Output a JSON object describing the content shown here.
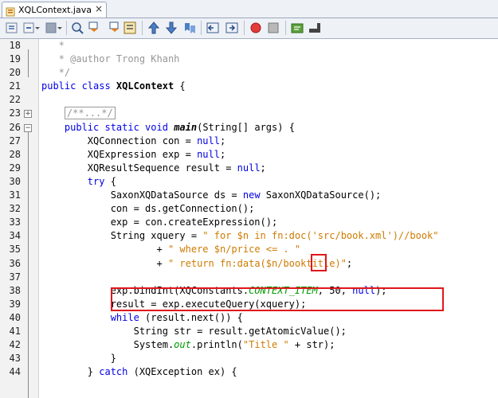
{
  "tab": {
    "label": "XQLContext.java",
    "close": "×"
  },
  "toolbar": {
    "icons": [
      "source-history-icon",
      "back-history-icon",
      "forward-history-icon",
      "find-icon",
      "prev-match-icon",
      "next-match-icon",
      "toggle-highlight-icon",
      "prev-bookmark-icon",
      "next-bookmark-icon",
      "toggle-bookmark-icon",
      "shift-left-icon",
      "shift-right-icon",
      "record-macro-icon",
      "stop-macro-icon",
      "comment-icon",
      "uncomment-icon"
    ]
  },
  "colors": {
    "keyword": "#0000e6",
    "string": "#ce7b00",
    "comment": "#969696",
    "constant": "#009900",
    "highlight": "#e0161b"
  },
  "code_lines": [
    {
      "n": "18",
      "segments": [
        {
          "t": "   *",
          "c": "cmt"
        }
      ]
    },
    {
      "n": "19",
      "segments": [
        {
          "t": "   * @author Trong Khanh",
          "c": "cmt"
        }
      ]
    },
    {
      "n": "20",
      "segments": [
        {
          "t": "   */",
          "c": "cmt"
        }
      ]
    },
    {
      "n": "21",
      "segments": [
        {
          "t": "public class ",
          "c": "kw"
        },
        {
          "t": "XQLContext",
          "c": "bold"
        },
        {
          "t": " {",
          "c": ""
        }
      ]
    },
    {
      "n": "22",
      "segments": []
    },
    {
      "n": "23",
      "segments": [
        {
          "t": "    ",
          "c": ""
        },
        {
          "t": "/**...*/",
          "c": "cmt collapsed"
        }
      ]
    },
    {
      "n": "26",
      "segments": [
        {
          "t": "    ",
          "c": ""
        },
        {
          "t": "public static void ",
          "c": "kw"
        },
        {
          "t": "main",
          "c": "bold ital"
        },
        {
          "t": "(String[] args) {",
          "c": ""
        }
      ]
    },
    {
      "n": "27",
      "segments": [
        {
          "t": "        XQConnection con = ",
          "c": ""
        },
        {
          "t": "null",
          "c": "kw"
        },
        {
          "t": ";",
          "c": ""
        }
      ]
    },
    {
      "n": "28",
      "segments": [
        {
          "t": "        XQExpression exp = ",
          "c": ""
        },
        {
          "t": "null",
          "c": "kw"
        },
        {
          "t": ";",
          "c": ""
        }
      ]
    },
    {
      "n": "29",
      "segments": [
        {
          "t": "        XQResultSequence result = ",
          "c": ""
        },
        {
          "t": "null",
          "c": "kw"
        },
        {
          "t": ";",
          "c": ""
        }
      ]
    },
    {
      "n": "30",
      "segments": [
        {
          "t": "        ",
          "c": ""
        },
        {
          "t": "try",
          "c": "kw"
        },
        {
          "t": " {",
          "c": ""
        }
      ]
    },
    {
      "n": "31",
      "segments": [
        {
          "t": "            SaxonXQDataSource ds = ",
          "c": ""
        },
        {
          "t": "new",
          "c": "kw"
        },
        {
          "t": " SaxonXQDataSource();",
          "c": ""
        }
      ]
    },
    {
      "n": "32",
      "segments": [
        {
          "t": "            con = ds.getConnection();",
          "c": ""
        }
      ]
    },
    {
      "n": "33",
      "segments": [
        {
          "t": "            exp = con.createExpression();",
          "c": ""
        }
      ]
    },
    {
      "n": "34",
      "segments": [
        {
          "t": "            String xquery = ",
          "c": ""
        },
        {
          "t": "\" for $n in fn:doc('src/book.xml')//book\"",
          "c": "str"
        }
      ]
    },
    {
      "n": "35",
      "segments": [
        {
          "t": "                    + ",
          "c": ""
        },
        {
          "t": "\" where $n/price <= . \"",
          "c": "str"
        }
      ]
    },
    {
      "n": "36",
      "segments": [
        {
          "t": "                    + ",
          "c": ""
        },
        {
          "t": "\" return fn:data($n/booktitle)\"",
          "c": "str"
        },
        {
          "t": ";",
          "c": ""
        }
      ]
    },
    {
      "n": "37",
      "segments": []
    },
    {
      "n": "38",
      "segments": [
        {
          "t": "            exp.bindInt(XQConstants.",
          "c": ""
        },
        {
          "t": "CONTEXT_ITEM",
          "c": "cst"
        },
        {
          "t": ", 50, ",
          "c": ""
        },
        {
          "t": "null",
          "c": "kw"
        },
        {
          "t": ");",
          "c": ""
        }
      ]
    },
    {
      "n": "39",
      "segments": [
        {
          "t": "            result = exp.executeQuery(xquery);",
          "c": ""
        }
      ]
    },
    {
      "n": "40",
      "segments": [
        {
          "t": "            ",
          "c": ""
        },
        {
          "t": "while",
          "c": "kw"
        },
        {
          "t": " (result.next()) {",
          "c": ""
        }
      ]
    },
    {
      "n": "41",
      "segments": [
        {
          "t": "                String str = result.getAtomicValue();",
          "c": ""
        }
      ]
    },
    {
      "n": "42",
      "segments": [
        {
          "t": "                System.",
          "c": ""
        },
        {
          "t": "out",
          "c": "cst"
        },
        {
          "t": ".println(",
          "c": ""
        },
        {
          "t": "\"Title \"",
          "c": "str"
        },
        {
          "t": " + str);",
          "c": ""
        }
      ]
    },
    {
      "n": "43",
      "segments": [
        {
          "t": "            }",
          "c": ""
        }
      ]
    },
    {
      "n": "44",
      "segments": [
        {
          "t": "        } ",
          "c": ""
        },
        {
          "t": "catch",
          "c": "kw"
        },
        {
          "t": " (XQException ex) {",
          "c": ""
        }
      ]
    }
  ]
}
